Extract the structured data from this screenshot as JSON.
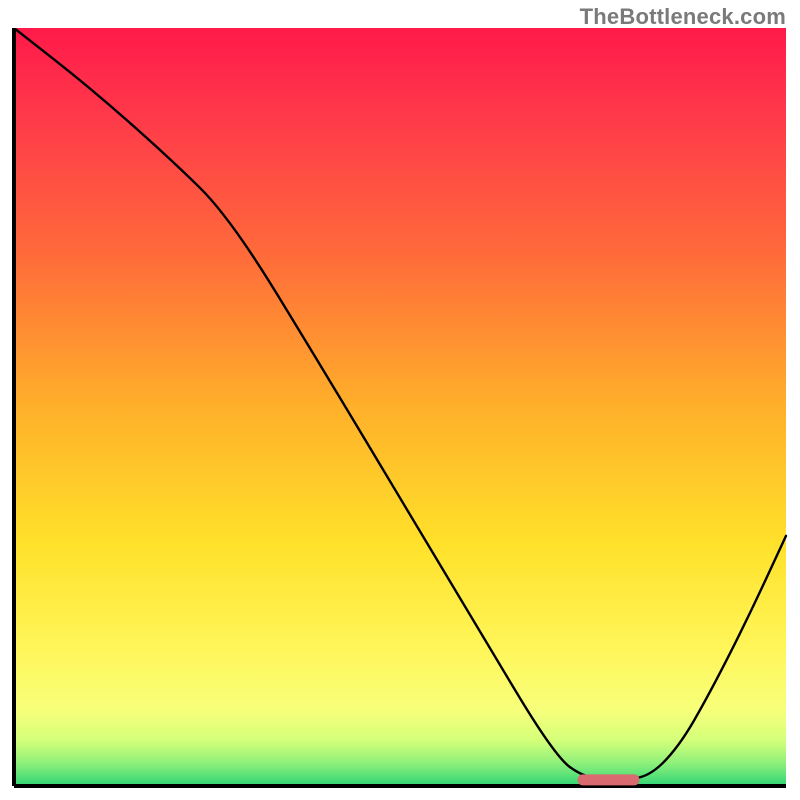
{
  "watermark": "TheBottleneck.com",
  "chart_data": {
    "type": "line",
    "title": "",
    "xlabel": "",
    "ylabel": "",
    "xlim": [
      0,
      100
    ],
    "ylim": [
      0,
      100
    ],
    "grid": false,
    "legend": false,
    "annotations": [],
    "series": [
      {
        "name": "curve",
        "x": [
          0,
          10,
          20,
          28,
          40,
          50,
          60,
          70,
          74,
          78,
          82,
          86,
          90,
          95,
          100
        ],
        "y": [
          100,
          92,
          83,
          75,
          55,
          38,
          21,
          4,
          1,
          1,
          1,
          5,
          12,
          22,
          33
        ]
      }
    ],
    "marker": {
      "name": "optimum-marker",
      "x_center": 77,
      "x_halfwidth": 4,
      "y": 0.8,
      "color": "#d96a6f"
    },
    "gradient_stops": [
      {
        "offset": 0.0,
        "color": "#ff1a4a"
      },
      {
        "offset": 0.12,
        "color": "#ff3a4a"
      },
      {
        "offset": 0.3,
        "color": "#ff6b3a"
      },
      {
        "offset": 0.5,
        "color": "#ffb02a"
      },
      {
        "offset": 0.68,
        "color": "#ffe12a"
      },
      {
        "offset": 0.82,
        "color": "#fff65a"
      },
      {
        "offset": 0.9,
        "color": "#f7ff7a"
      },
      {
        "offset": 0.94,
        "color": "#d4ff7a"
      },
      {
        "offset": 0.97,
        "color": "#8ef07a"
      },
      {
        "offset": 1.0,
        "color": "#2fd576"
      }
    ],
    "axis_color": "#000000",
    "line_color": "#000000",
    "line_width": 2.4
  }
}
